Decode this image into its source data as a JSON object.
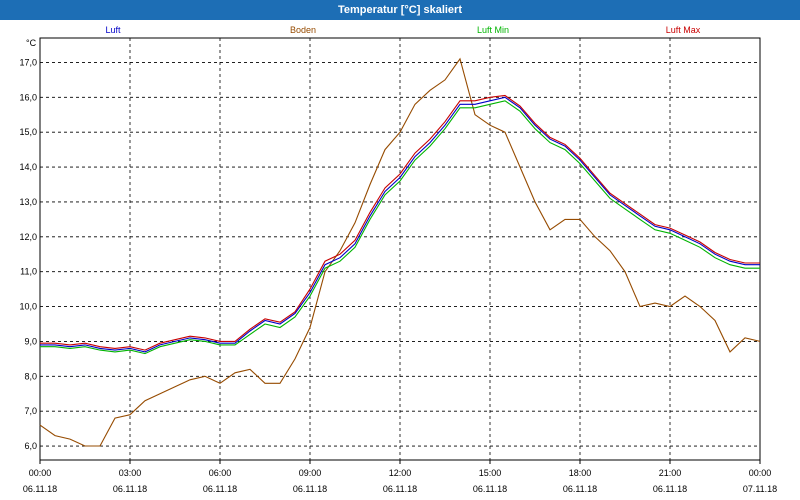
{
  "window": {
    "title": "Temperatur [°C] skaliert"
  },
  "chart_data": {
    "type": "line",
    "title": "Temperatur [°C] skaliert",
    "ylabel": "°C",
    "xlabel": "",
    "ylim": [
      5.6,
      17.7
    ],
    "xlim": [
      0,
      24
    ],
    "grid": true,
    "legend_position": "top",
    "yticks": [
      6.0,
      7.0,
      8.0,
      9.0,
      10.0,
      11.0,
      12.0,
      13.0,
      14.0,
      15.0,
      16.0,
      17.0
    ],
    "ytick_labels": [
      "6,0",
      "7,0",
      "8,0",
      "9,0",
      "10,0",
      "11,0",
      "12,0",
      "13,0",
      "14,0",
      "15,0",
      "16,0",
      "17,0"
    ],
    "xticks": [
      {
        "value": 0,
        "time": "00:00",
        "date": "06.11.18"
      },
      {
        "value": 3,
        "time": "03:00",
        "date": "06.11.18"
      },
      {
        "value": 6,
        "time": "06:00",
        "date": "06.11.18"
      },
      {
        "value": 9,
        "time": "09:00",
        "date": "06.11.18"
      },
      {
        "value": 12,
        "time": "12:00",
        "date": "06.11.18"
      },
      {
        "value": 15,
        "time": "15:00",
        "date": "06.11.18"
      },
      {
        "value": 18,
        "time": "18:00",
        "date": "06.11.18"
      },
      {
        "value": 21,
        "time": "21:00",
        "date": "06.11.18"
      },
      {
        "value": 24,
        "time": "00:00",
        "date": "07.11.18"
      }
    ],
    "x": [
      0,
      0.5,
      1,
      1.5,
      2,
      2.5,
      3,
      3.5,
      4,
      4.5,
      5,
      5.5,
      6,
      6.5,
      7,
      7.5,
      8,
      8.5,
      9,
      9.5,
      10,
      10.5,
      11,
      11.5,
      12,
      12.5,
      13,
      13.5,
      14,
      14.5,
      15,
      15.5,
      16,
      16.5,
      17,
      17.5,
      18,
      18.5,
      19,
      19.5,
      20,
      20.5,
      21,
      21.5,
      22,
      22.5,
      23,
      23.5,
      24
    ],
    "series": [
      {
        "name": "Luft",
        "color": "#0000c8",
        "values": [
          8.9,
          8.9,
          8.85,
          8.9,
          8.8,
          8.75,
          8.8,
          8.7,
          8.9,
          9.0,
          9.1,
          9.05,
          8.95,
          8.95,
          9.3,
          9.6,
          9.5,
          9.8,
          10.4,
          11.2,
          11.4,
          11.8,
          12.6,
          13.3,
          13.7,
          14.3,
          14.7,
          15.2,
          15.8,
          15.8,
          15.9,
          16.0,
          15.7,
          15.2,
          14.8,
          14.6,
          14.2,
          13.7,
          13.2,
          12.9,
          12.6,
          12.3,
          12.2,
          12.0,
          11.8,
          11.5,
          11.3,
          11.2,
          11.2
        ]
      },
      {
        "name": "Boden",
        "color": "#964b00",
        "values": [
          6.6,
          6.3,
          6.2,
          6.0,
          6.0,
          6.8,
          6.9,
          7.3,
          7.5,
          7.7,
          7.9,
          8.0,
          7.8,
          8.1,
          8.2,
          7.8,
          7.8,
          8.5,
          9.4,
          11.0,
          11.6,
          12.4,
          13.5,
          14.5,
          15.0,
          15.8,
          16.2,
          16.5,
          17.1,
          15.5,
          15.2,
          15.0,
          14.0,
          13.0,
          12.2,
          12.5,
          12.5,
          12.0,
          11.6,
          11.0,
          10.0,
          10.1,
          10.0,
          10.3,
          10.0,
          9.6,
          8.7,
          9.1,
          9.0
        ]
      },
      {
        "name": "Luft Min",
        "color": "#00b400",
        "values": [
          8.85,
          8.85,
          8.8,
          8.85,
          8.75,
          8.7,
          8.75,
          8.65,
          8.85,
          8.95,
          9.05,
          9.0,
          8.9,
          8.9,
          9.2,
          9.5,
          9.4,
          9.7,
          10.3,
          11.1,
          11.3,
          11.7,
          12.5,
          13.2,
          13.6,
          14.2,
          14.6,
          15.1,
          15.7,
          15.7,
          15.8,
          15.9,
          15.6,
          15.1,
          14.7,
          14.5,
          14.1,
          13.6,
          13.1,
          12.8,
          12.5,
          12.2,
          12.1,
          11.9,
          11.7,
          11.4,
          11.2,
          11.1,
          11.1
        ]
      },
      {
        "name": "Luft Max",
        "color": "#c80000",
        "values": [
          8.95,
          8.95,
          8.9,
          8.95,
          8.85,
          8.8,
          8.85,
          8.75,
          8.95,
          9.05,
          9.15,
          9.1,
          9.0,
          9.0,
          9.35,
          9.65,
          9.55,
          9.85,
          10.5,
          11.3,
          11.5,
          11.9,
          12.7,
          13.4,
          13.8,
          14.4,
          14.8,
          15.3,
          15.9,
          15.9,
          16.0,
          16.05,
          15.75,
          15.25,
          14.85,
          14.65,
          14.25,
          13.75,
          13.25,
          12.95,
          12.65,
          12.35,
          12.25,
          12.05,
          11.85,
          11.55,
          11.35,
          11.25,
          11.25
        ]
      }
    ]
  }
}
